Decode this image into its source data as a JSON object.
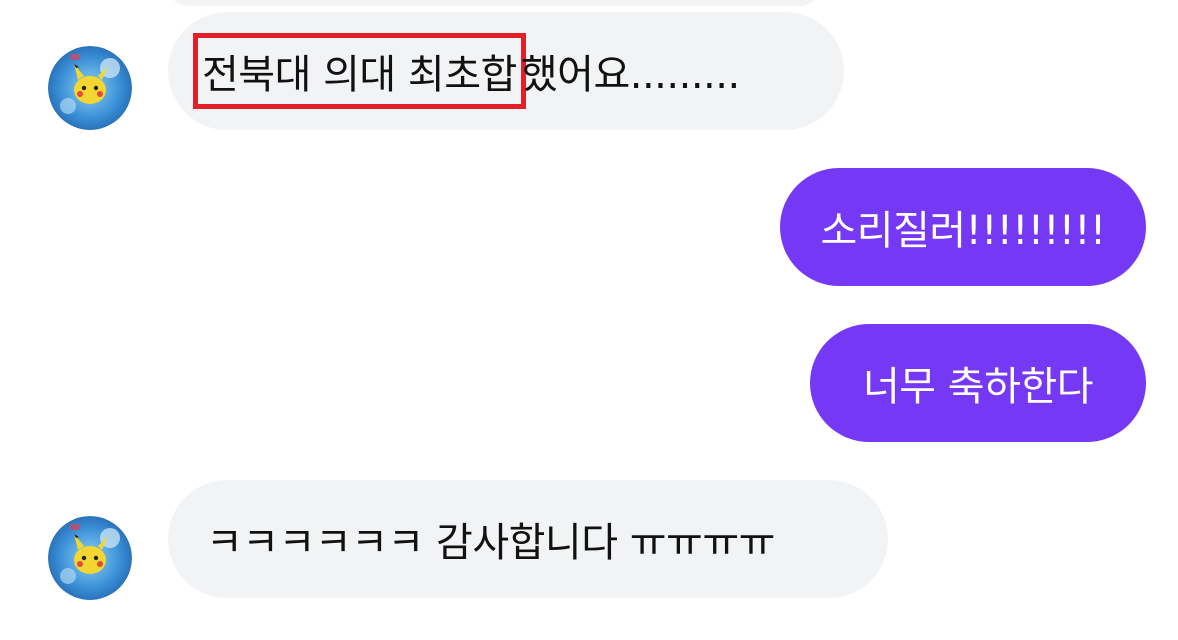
{
  "messages": [
    {
      "sender": "other",
      "highlighted_text": "전북대 의대 최초합",
      "rest_text": "했어요.........",
      "avatar": "pikachu-avatar-icon"
    },
    {
      "sender": "me",
      "text": "소리질러!!!!!!!!!"
    },
    {
      "sender": "me",
      "text": "너무 축하한다"
    },
    {
      "sender": "other",
      "text": "ㅋㅋㅋㅋㅋㅋ 감사합니다 ㅠㅠㅠㅠ",
      "avatar": "pikachu-avatar-icon"
    }
  ],
  "colors": {
    "incoming_bubble": "#f2f3f5",
    "outgoing_bubble": "#7538f5",
    "highlight_box": "#e3202a"
  }
}
